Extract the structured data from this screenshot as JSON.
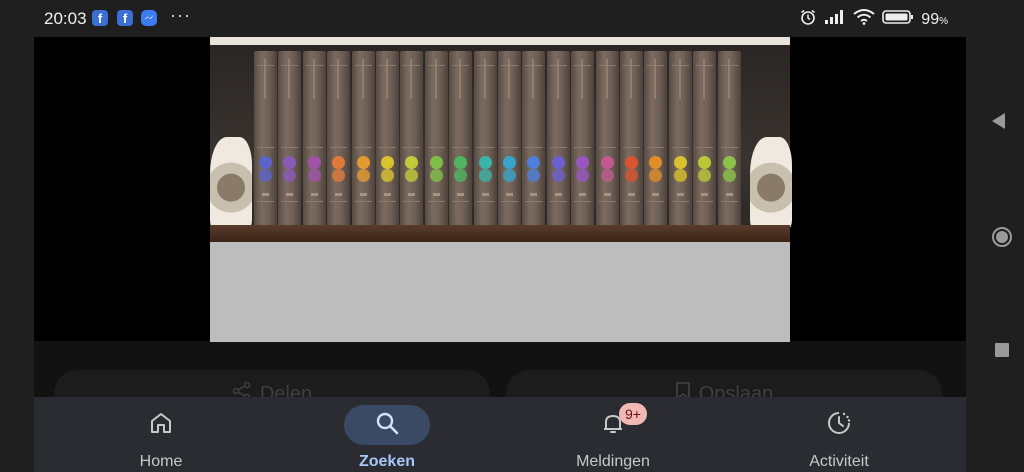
{
  "status_bar": {
    "time": "20:03",
    "notification_icons": [
      "facebook-icon",
      "facebook-icon",
      "messenger-icon"
    ],
    "battery": "99",
    "battery_unit": "%"
  },
  "content": {
    "share_label": "Delen",
    "save_label": "Opslaan"
  },
  "photo": {
    "subject": "bookshelf",
    "volume_emblem_colors": [
      "#5b63c9",
      "#8a5ab8",
      "#a052a8",
      "#e07a3a",
      "#e39a2e",
      "#d9c230",
      "#c4c93a",
      "#7fbf48",
      "#4fb55f",
      "#3bb3a8",
      "#3aa3c9",
      "#4d7fd8",
      "#6d5fd0",
      "#9a55c0",
      "#c05a8e",
      "#d9542f",
      "#e08d2a",
      "#d8c12c",
      "#bcc736",
      "#8bc34a"
    ]
  },
  "bottom_nav": {
    "items": [
      {
        "label": "Home",
        "icon": "home-icon"
      },
      {
        "label": "Zoeken",
        "icon": "search-icon",
        "selected": true
      },
      {
        "label": "Meldingen",
        "icon": "bell-icon",
        "badge": "9+"
      },
      {
        "label": "Activiteit",
        "icon": "activity-icon"
      }
    ]
  }
}
